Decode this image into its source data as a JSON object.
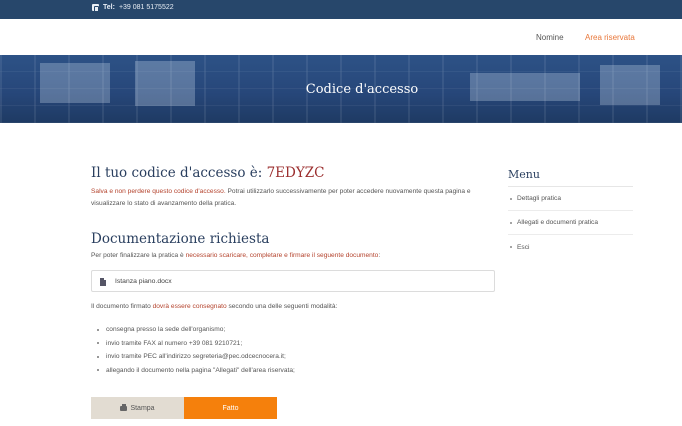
{
  "topbar": {
    "phone_label": "Tel:",
    "phone_number": "+39 081 5175522"
  },
  "nav": {
    "items": [
      {
        "label": "Nomine"
      },
      {
        "label": "Area riservata"
      }
    ]
  },
  "hero": {
    "title": "Codice d'accesso"
  },
  "code_section": {
    "heading": "Il tuo codice d'accesso è:",
    "code": "7EDYZC",
    "warning": "Salva e non perdere questo codice d'accesso.",
    "info": " Potrai utilizzarlo successivamente per poter accedere nuovamente questa pagina e visualizzare lo stato di avanzamento della pratica."
  },
  "documentation": {
    "heading": "Documentazione richiesta",
    "intro_prefix": "Per poter finalizzare la pratica è ",
    "intro_highlight": "necessario scaricare, completare e firmare il seguente documento",
    "intro_suffix": ":",
    "file_name": "Istanza piano.docx",
    "signed_prefix": "Il documento firmato ",
    "signed_highlight": "dovrà essere consegnato",
    "signed_suffix": " secondo una delle seguenti modalità:",
    "modes": [
      "consegna presso la sede dell'organismo;",
      "invio tramite FAX al numero +39 081 9210721;",
      "invio tramite PEC all'indirizzo segreteria@pec.odcecnocera.it;",
      "allegando il documento nella pagina \"Allegati\" dell'area riservata;"
    ]
  },
  "buttons": {
    "print_label": "Stampa",
    "done_label": "Fatto"
  },
  "sidebar": {
    "title": "Menu",
    "items": [
      "Dettagli pratica",
      "Allegati e documenti pratica",
      "Esci"
    ]
  },
  "colors": {
    "topbar": "#27476b",
    "accent": "#f5800c",
    "highlight": "#b4432d",
    "heading": "#2a3f5f"
  },
  "icons": {
    "phone": "phone-icon",
    "file": "file-icon",
    "print": "printer-icon"
  }
}
